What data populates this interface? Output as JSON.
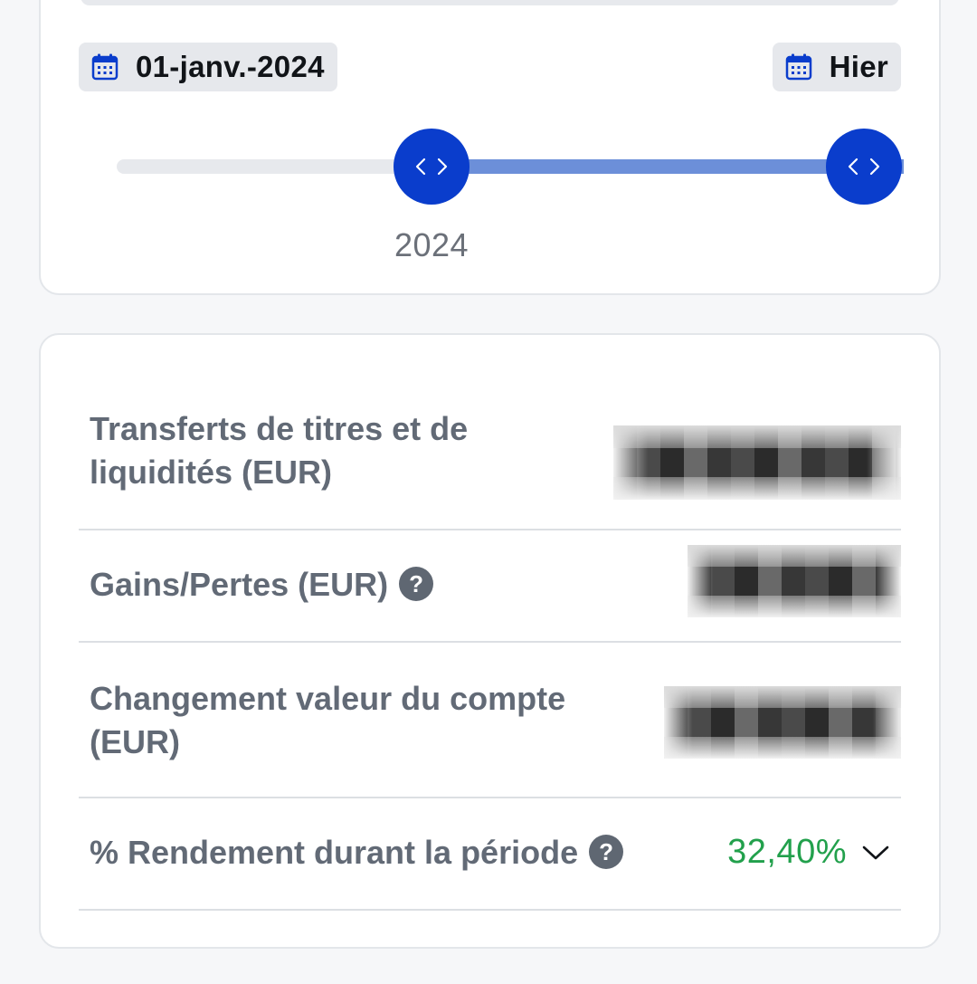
{
  "date_range": {
    "start_label": "01-janv.-2024",
    "end_label": "Hier",
    "slider_tick_label": "2024",
    "range_start_fraction": 0.41,
    "range_end_fraction": 1.0
  },
  "stats": {
    "rows": [
      {
        "label": "Transferts de titres et de liquidités (EUR)",
        "value": "",
        "help": false
      },
      {
        "label": "Gains/Pertes (EUR)",
        "value": "",
        "help": true
      },
      {
        "label": "Changement valeur du compte (EUR)",
        "value": "",
        "help": false
      },
      {
        "label": "% Rendement durant la période",
        "value": "32,40%",
        "help": true
      }
    ],
    "help_glyph": "?"
  },
  "colors": {
    "accent": "#0a3dcc",
    "range_fill": "#6c8fd9",
    "positive": "#22a04c"
  },
  "icons": [
    "calendar-icon",
    "code-brackets-icon",
    "help-icon",
    "chevron-down-icon"
  ]
}
